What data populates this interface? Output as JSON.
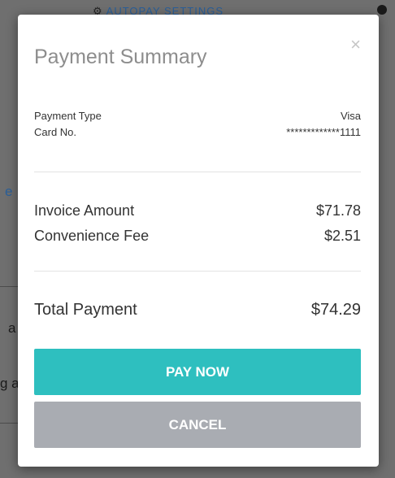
{
  "background": {
    "header_label": "AUTOPAY SETTINGS",
    "frag_link": "e",
    "frag_a": "a",
    "frag_g": "g a",
    "gear_icon": "gear-icon"
  },
  "modal": {
    "title": "Payment Summary",
    "close_label": "×",
    "payment_type_label": "Payment Type",
    "payment_type_value": "Visa",
    "card_no_label": "Card No.",
    "card_no_value": "*************1111",
    "invoice_amount_label": "Invoice Amount",
    "invoice_amount_value": "$71.78",
    "convenience_fee_label": "Convenience Fee",
    "convenience_fee_value": "$2.51",
    "total_payment_label": "Total Payment",
    "total_payment_value": "$74.29",
    "pay_now_label": "PAY NOW",
    "cancel_label": "CANCEL"
  },
  "colors": {
    "pay_now": "#2ebfbf",
    "cancel": "#a9acb2",
    "backdrop": "#6f6f6f"
  }
}
